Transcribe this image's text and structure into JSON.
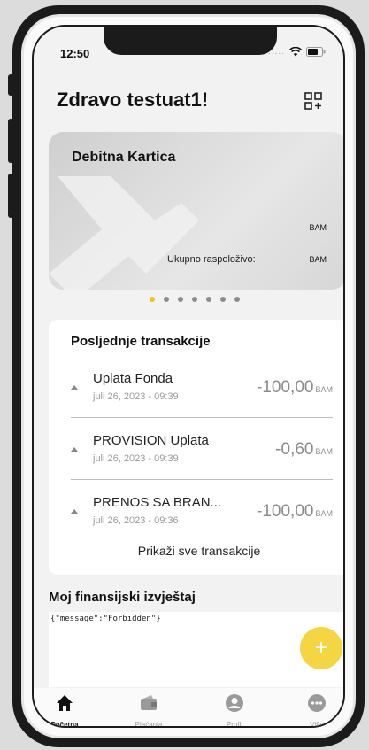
{
  "status": {
    "time": "12:50",
    "signal_dots": "....."
  },
  "header": {
    "greeting": "Zdravo testuat1!"
  },
  "card": {
    "title": "Debitna Kartica",
    "currency_top": "BAM",
    "available_label": "Ukupno raspoloživo:",
    "currency_bottom": "BAM"
  },
  "pager": {
    "count": 7,
    "active_index": 0
  },
  "transactions": {
    "title": "Posljednje transakcije",
    "items": [
      {
        "name": "Uplata Fonda",
        "date": "juli 26, 2023 - 09:39",
        "amount": "-100,00",
        "currency": "BAM"
      },
      {
        "name": "PROVISION Uplata",
        "date": "juli 26, 2023 - 09:39",
        "amount": "-0,60",
        "currency": "BAM"
      },
      {
        "name": "PRENOS SA BRAN...",
        "date": "juli 26, 2023 - 09:36",
        "amount": "-100,00",
        "currency": "BAM"
      }
    ],
    "show_all": "Prikaži sve transakcije"
  },
  "finance": {
    "title": "Moj finansijski izvještaj",
    "response": "{\"message\":\"Forbidden\"}"
  },
  "fab": {
    "symbol": "+"
  },
  "tabs": [
    {
      "label": "Početna",
      "icon": "home-icon",
      "active": true
    },
    {
      "label": "Plaćanja",
      "icon": "wallet-icon",
      "active": false
    },
    {
      "label": "Profil",
      "icon": "user-icon",
      "active": false
    },
    {
      "label": "Više",
      "icon": "more-icon",
      "active": false
    }
  ],
  "colors": {
    "accent": "#f3c515",
    "fab": "#f4d542",
    "text": "#111111",
    "muted": "#9a9a9a"
  }
}
